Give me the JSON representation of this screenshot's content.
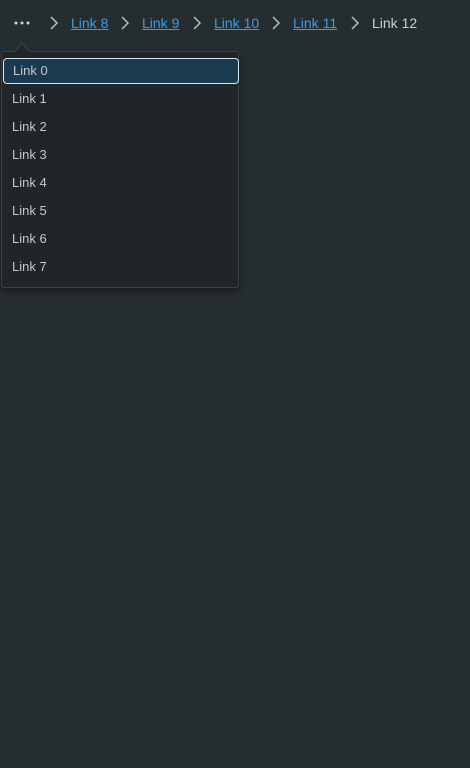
{
  "breadcrumb": {
    "overflow_icon": "more-horizontal-icon",
    "separator_icon": "chevron-right-icon",
    "links": [
      "Link 8",
      "Link 9",
      "Link 10",
      "Link 11"
    ],
    "current": "Link 12"
  },
  "menu": {
    "items": [
      "Link 0",
      "Link 1",
      "Link 2",
      "Link 3",
      "Link 4",
      "Link 5",
      "Link 6",
      "Link 7"
    ],
    "focused_index": 0
  },
  "colors": {
    "background": "#262d31",
    "link": "#3b9be8",
    "text": "#c9cfd3",
    "menu_background": "#1f2528",
    "focus_background": "#1a3a4f",
    "focus_border": "#d8e6ee"
  }
}
